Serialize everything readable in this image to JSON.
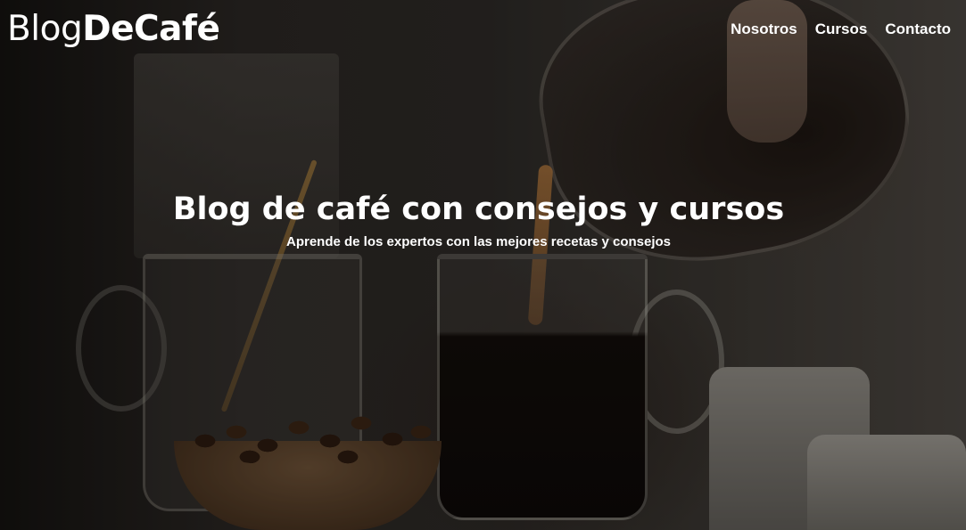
{
  "header": {
    "logo_part1": "Blog",
    "logo_part2": "DeCafé",
    "nav": [
      {
        "label": "Nosotros"
      },
      {
        "label": "Cursos"
      },
      {
        "label": "Contacto"
      }
    ]
  },
  "hero": {
    "title": "Blog de café con consejos y cursos",
    "subtitle": "Aprende de los expertos con las mejores recetas y consejos"
  },
  "colors": {
    "text": "#ffffff",
    "overlay": "#1a1714"
  }
}
